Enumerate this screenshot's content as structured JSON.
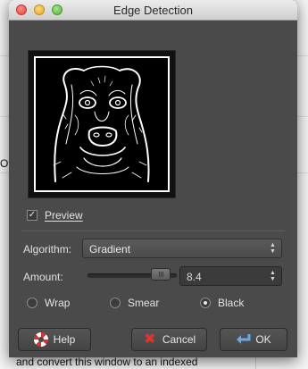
{
  "dialog": {
    "title": "Edge Detection",
    "preview": {
      "label": "Preview",
      "checked": true
    },
    "algorithm": {
      "label": "Algorithm:",
      "value": "Gradient"
    },
    "amount": {
      "label": "Amount:",
      "value": "8.4",
      "slider_fraction": 0.82
    },
    "wrap_modes": [
      {
        "label": "Wrap",
        "selected": false
      },
      {
        "label": "Smear",
        "selected": false
      },
      {
        "label": "Black",
        "selected": true
      }
    ],
    "buttons": {
      "help": "Help",
      "cancel": "Cancel",
      "ok": "OK"
    }
  },
  "background": {
    "side_fragment": "Ot",
    "bottom_text": "and convert this window to an indexed"
  },
  "colors": {
    "dialog_bg": "#4a4a4a",
    "cancel_icon": "#e0342b",
    "ok_icon": "#6aa8e8"
  },
  "icons": [
    "lifebuoy-icon",
    "cancel-x-icon",
    "return-arrow-icon"
  ]
}
